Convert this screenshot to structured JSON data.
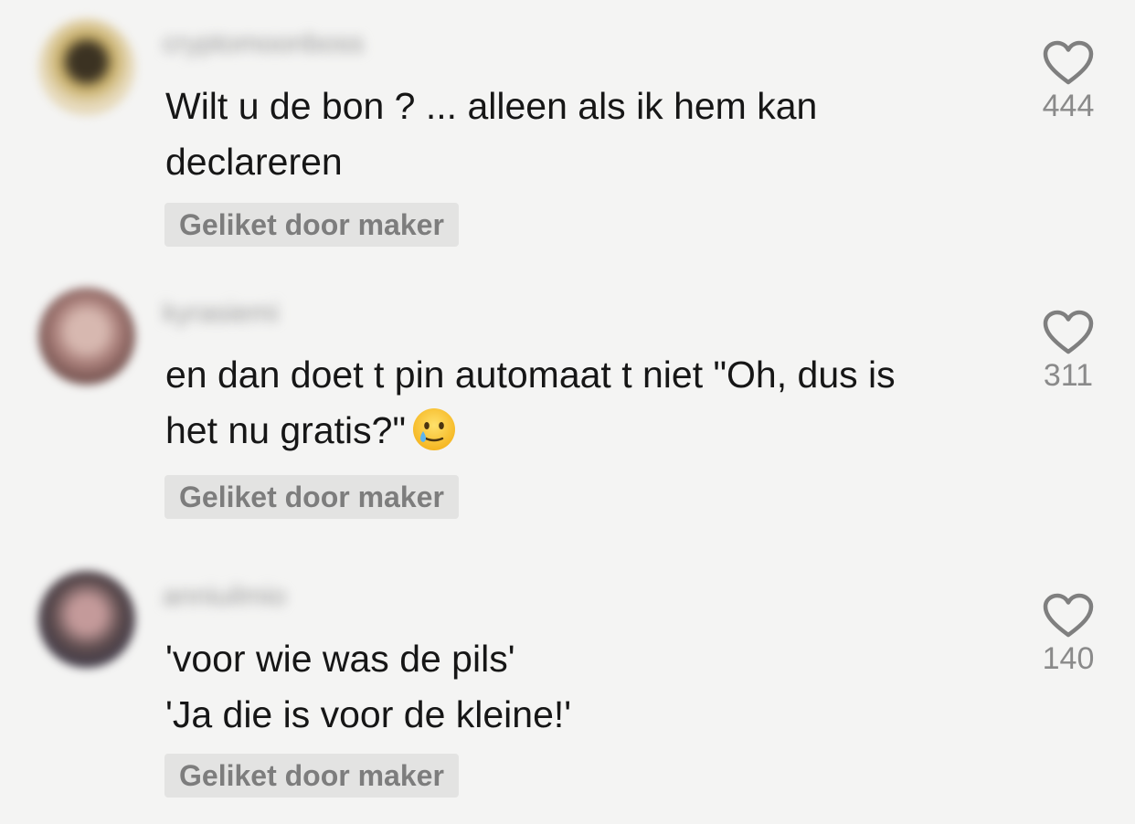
{
  "comments": [
    {
      "username": "cryptomoonboss",
      "text": "Wilt u de bon ? ... alleen als ik hem kan\ndeclareren",
      "liked_by_creator": "Geliket door maker",
      "likes": "444",
      "avatar_colors": [
        "#c9b06a",
        "#3b3222",
        "#e8dcc0"
      ]
    },
    {
      "username": "kyrasiemi",
      "text": "en dan doet t pin automaat t niet \"Oh, dus is\nhet nu gratis?\"",
      "emoji": "smiling-face-with-tear-icon",
      "liked_by_creator": "Geliket door maker",
      "likes": "311",
      "avatar_colors": [
        "#a97f7a",
        "#6b4a47",
        "#d7b8b0"
      ]
    },
    {
      "username": "anniuilmio",
      "text": "'voor wie was de pils'\n'Ja die is voor de kleine!'",
      "liked_by_creator": "Geliket door maker",
      "likes": "140",
      "avatar_colors": [
        "#5b4a4c",
        "#3d3a4a",
        "#c49a9a"
      ]
    }
  ],
  "colors": {
    "background": "#f4f4f3",
    "text": "#161616",
    "badge_background": "#e3e3e2",
    "badge_text": "#7d7d7d",
    "like_icon": "#7f7f7f",
    "like_count": "#8a8a8a"
  }
}
